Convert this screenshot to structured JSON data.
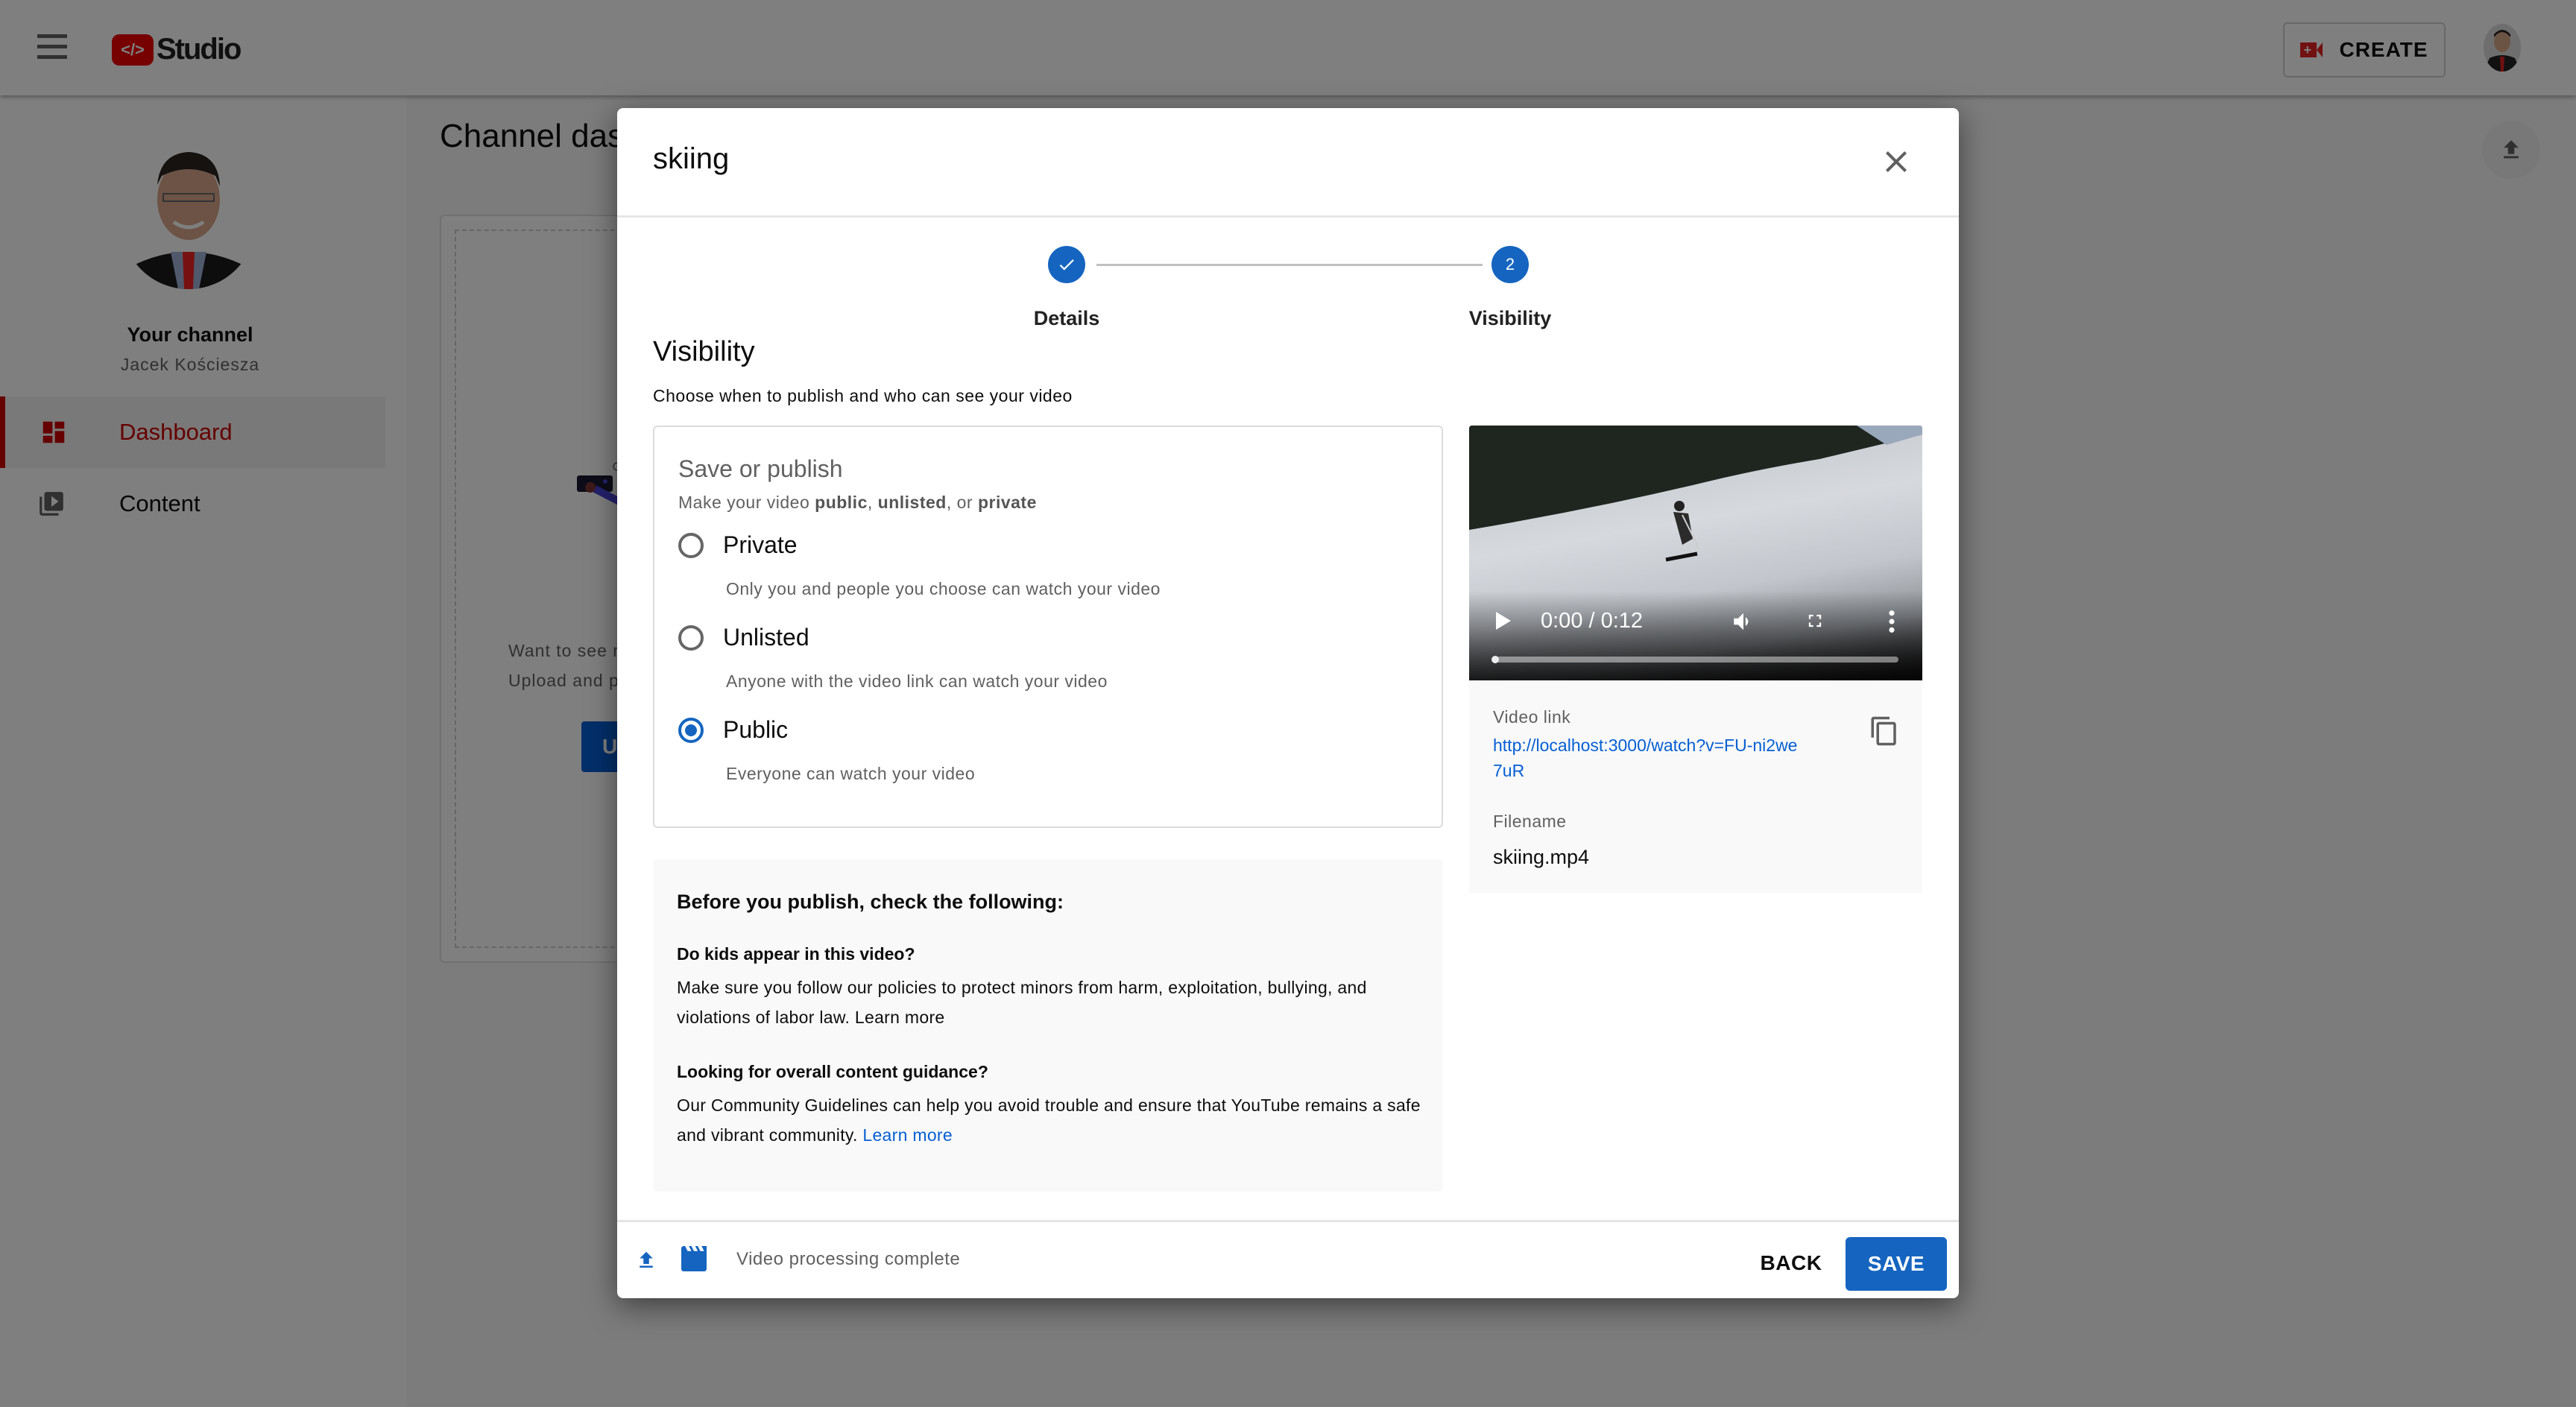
{
  "app": {
    "logo_badge": "</>",
    "logo_text": "Studio",
    "create_label": "CREATE",
    "icons": {
      "menu": "hamburger-menu-icon",
      "create": "video-camera-plus-icon",
      "upload_fab": "upload-icon"
    }
  },
  "sidebar": {
    "channel_title": "Your channel",
    "channel_name": "Jacek Kościesza",
    "items": [
      {
        "label": "Dashboard",
        "icon": "dashboard-icon",
        "active": true
      },
      {
        "label": "Content",
        "icon": "video-library-icon",
        "active": false
      }
    ]
  },
  "main": {
    "title": "Channel dashboard",
    "card_text_1": "Want to see metrics on your recent video?",
    "card_text_2": "Upload and publish a video to get started.",
    "upload_button": "UPLOAD VIDEOS"
  },
  "modal": {
    "title": "skiing",
    "close_icon": "close-icon",
    "stepper": [
      {
        "label": "Details",
        "state": "complete",
        "marker": "✓"
      },
      {
        "label": "Visibility",
        "state": "active",
        "marker": "2"
      }
    ],
    "section_title": "Visibility",
    "section_subtitle": "Choose when to publish and who can see your video",
    "publish": {
      "title": "Save or publish",
      "subtitle_prefix": "Make your video ",
      "subtitle_public": "public",
      "subtitle_sep1": ", ",
      "subtitle_unlisted": "unlisted",
      "subtitle_sep2": ", or ",
      "subtitle_private": "private",
      "selected": "Public",
      "options": [
        {
          "label": "Private",
          "description": "Only you and people you choose can watch your video",
          "checked": false
        },
        {
          "label": "Unlisted",
          "description": "Anyone with the video link can watch your video",
          "checked": false
        },
        {
          "label": "Public",
          "description": "Everyone can watch your video",
          "checked": true
        }
      ]
    },
    "checklist": {
      "title": "Before you publish, check the following:",
      "kids_heading": "Do kids appear in this video?",
      "kids_text": "Make sure you follow our policies to protect minors from harm, exploitation, bullying, and violations of labor law. Learn more",
      "guidance_heading": "Looking for overall content guidance?",
      "guidance_text": "Our Community Guidelines can help you avoid trouble and ensure that YouTube remains a safe and vibrant community. ",
      "guidance_link": "Learn more"
    },
    "video": {
      "time": "0:00 / 0:12",
      "progress_fraction": 0.0,
      "link_label": "Video link",
      "link": "http://localhost:3000/watch?v=FU-ni2we7uR",
      "filename_label": "Filename",
      "filename": "skiing.mp4",
      "icons": {
        "play": "play-icon",
        "volume": "volume-icon",
        "fullscreen": "fullscreen-icon",
        "more": "more-vert-icon",
        "copy": "copy-icon"
      }
    },
    "footer": {
      "status": "Video processing complete",
      "back_label": "BACK",
      "save_label": "SAVE"
    }
  },
  "colors": {
    "accent_blue": "#1565c0",
    "link_blue": "#065fd4",
    "brand_red": "#cc0000",
    "scrim": "rgba(0,0,0,0.5)"
  }
}
